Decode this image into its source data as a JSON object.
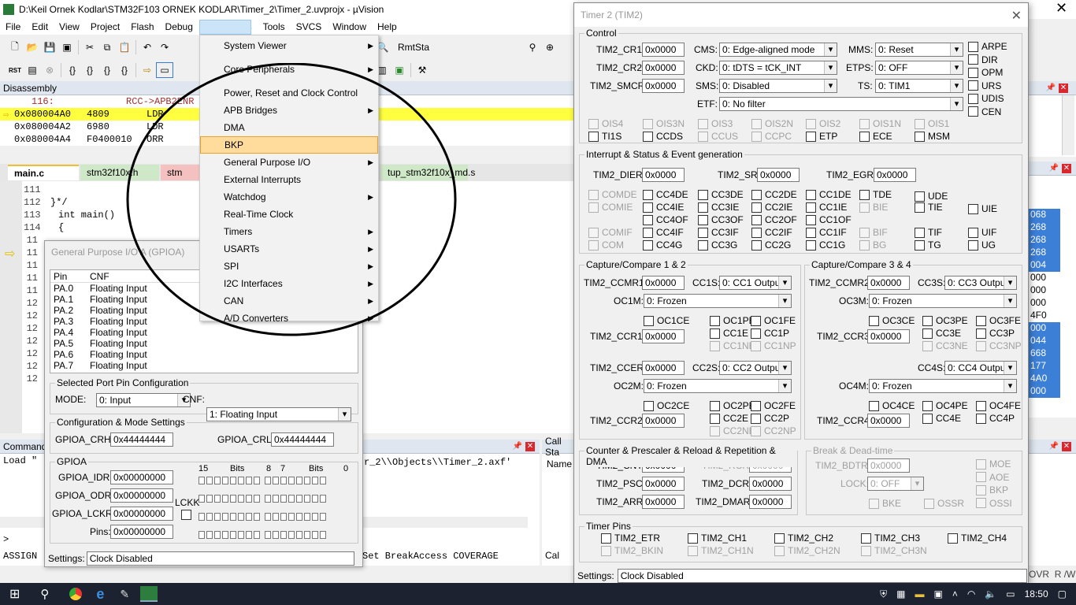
{
  "window_title": "D:\\Keil Ornek Kodlar\\STM32F103 ORNEK KODLAR\\Timer_2\\Timer_2.uvprojx - µVision",
  "menubar": [
    "File",
    "Edit",
    "View",
    "Project",
    "Flash",
    "Debug",
    "Peripherals",
    "Tools",
    "SVCS",
    "Window",
    "Help"
  ],
  "toolbar": {
    "rmtsta": "RmtSta",
    "rst": "RST"
  },
  "disassembly": {
    "title": "Disassembly",
    "lines": [
      {
        "addr": "116:",
        "op": "",
        "instr": "RCC->APB2ENR"
      },
      {
        "addr": "0x080004A0",
        "op": "4809",
        "instr": "LDR"
      },
      {
        "addr": "0x080004A2",
        "op": "6980",
        "instr": "LDR"
      },
      {
        "addr": "0x080004A4",
        "op": "F0400010",
        "instr": "ORR"
      }
    ]
  },
  "editor": {
    "tabs": [
      "main.c",
      "stm32f10x.h",
      "stm",
      "tup_stm32f10x_md.s"
    ],
    "lines": [
      {
        "n": "111",
        "t": ""
      },
      {
        "n": "112",
        "t": "}*/"
      },
      {
        "n": "113",
        "t": "int main()"
      },
      {
        "n": "114",
        "t": "{"
      },
      {
        "n": "11",
        "t": ""
      },
      {
        "n": "11",
        "t": ""
      },
      {
        "n": "11",
        "t": ""
      },
      {
        "n": "11",
        "t": ""
      },
      {
        "n": "11",
        "t": ""
      },
      {
        "n": "12",
        "t": ""
      },
      {
        "n": "12",
        "t": ""
      },
      {
        "n": "12",
        "t": ""
      },
      {
        "n": "12",
        "t": ""
      },
      {
        "n": "12",
        "t": ""
      },
      {
        "n": "12",
        "t": ""
      },
      {
        "n": "12",
        "t": ""
      }
    ]
  },
  "peripherals_menu": [
    {
      "label": "System Viewer",
      "sub": true
    },
    {
      "label": "Core Peripherals",
      "sub": true
    },
    {
      "label": "Power, Reset and Clock Control",
      "sub": false
    },
    {
      "label": "APB Bridges",
      "sub": true
    },
    {
      "label": "DMA",
      "sub": false
    },
    {
      "label": "BKP",
      "sub": false
    },
    {
      "label": "General Purpose I/O",
      "sub": true
    },
    {
      "label": "External Interrupts",
      "sub": false
    },
    {
      "label": "Watchdog",
      "sub": true
    },
    {
      "label": "Real-Time Clock",
      "sub": false
    },
    {
      "label": "Timers",
      "sub": true
    },
    {
      "label": "USARTs",
      "sub": true
    },
    {
      "label": "SPI",
      "sub": true
    },
    {
      "label": "I2C Interfaces",
      "sub": true
    },
    {
      "label": "CAN",
      "sub": true
    },
    {
      "label": "A/D Converters",
      "sub": true
    }
  ],
  "gpioa": {
    "title": "General Purpose I/O A (GPIOA)",
    "col_pin": "Pin",
    "col_cnf": "CNF",
    "pins": [
      {
        "pin": "PA.0",
        "cnf": "Floating Input"
      },
      {
        "pin": "PA.1",
        "cnf": "Floating Input"
      },
      {
        "pin": "PA.2",
        "cnf": "Floating Input"
      },
      {
        "pin": "PA.3",
        "cnf": "Floating Input"
      },
      {
        "pin": "PA.4",
        "cnf": "Floating Input"
      },
      {
        "pin": "PA.5",
        "cnf": "Floating Input"
      },
      {
        "pin": "PA.6",
        "cnf": "Floating Input"
      },
      {
        "pin": "PA.7",
        "cnf": "Floating Input"
      }
    ],
    "sel_group": "Selected Port Pin Configuration",
    "mode_label": "MODE:",
    "mode_value": "0: Input",
    "cnf_label": "CNF:",
    "cnf_value": "1: Floating Input",
    "cfg_group": "Configuration & Mode Settings",
    "crh_label": "GPIOA_CRH:",
    "crh_value": "0x44444444",
    "crl_label": "GPIOA_CRL:",
    "crl_value": "0x44444444",
    "gpioa_group": "GPIOA",
    "idr_label": "GPIOA_IDR:",
    "idr_value": "0x00000000",
    "odr_label": "GPIOA_ODR:",
    "odr_value": "0x00000000",
    "lckr_label": "GPIOA_LCKR:",
    "lckr_value": "0x00000000",
    "pins_label": "Pins:",
    "pins_value": "0x00000000",
    "lckk": "LCKK",
    "bits_hdr": [
      "15",
      "Bits",
      "8",
      "7",
      "Bits",
      "0"
    ],
    "settings_label": "Settings:",
    "settings_value": "Clock Disabled"
  },
  "command": {
    "title": "Command",
    "line1": "Load \"",
    "line2": "r_2\\\\Objects\\\\Timer_2.axf'",
    "prompt": ">",
    "status": "ASSIGN",
    "status2": "Set BreakAccess COVERAGE"
  },
  "callstack": {
    "title": "Call Sta",
    "name": "Name",
    "tab": "Cal"
  },
  "memory_vals": [
    "068",
    "268",
    "268",
    "268",
    "004",
    "000",
    "000",
    "000",
    "4F0",
    "000",
    "044",
    "668",
    "177",
    "4A0",
    "000"
  ],
  "tim2": {
    "title": "Timer 2 (TIM2)",
    "control": "Control",
    "cr1_l": "TIM2_CR1:",
    "cr1": "0x0000",
    "cr2_l": "TIM2_CR2:",
    "cr2": "0x0000",
    "smcr_l": "TIM2_SMCR:",
    "smcr": "0x0000",
    "cms_l": "CMS:",
    "cms": "0: Edge-aligned mode",
    "ckd_l": "CKD:",
    "ckd": "0: tDTS = tCK_INT",
    "sms_l": "SMS:",
    "sms": "0: Disabled",
    "etf_l": "ETF:",
    "etf": "0:  No filter",
    "mms_l": "MMS:",
    "mms": "0: Reset",
    "etps_l": "ETPS:",
    "etps": "0: OFF",
    "ts_l": "TS:",
    "ts": "0: TIM1",
    "cr_flags": [
      "ARPE",
      "DIR",
      "OPM",
      "URS",
      "UDIS",
      "CEN"
    ],
    "ois_row": [
      "OIS4",
      "OIS3N",
      "OIS3",
      "OIS2N",
      "OIS2",
      "OIS1N",
      "OIS1"
    ],
    "ti_row": [
      "TI1S",
      "CCDS",
      "CCUS",
      "CCPC",
      "ETP",
      "ECE",
      "MSM"
    ],
    "interrupt": "Interrupt & Status & Event generation",
    "dier_l": "TIM2_DIER:",
    "dier": "0x0000",
    "sr_l": "TIM2_SR:",
    "sr": "0x0000",
    "egr_l": "TIM2_EGR:",
    "egr": "0x0000",
    "int_rows": [
      [
        "COMDE",
        "CC4DE",
        "CC3DE",
        "CC2DE",
        "CC1DE",
        "TDE",
        "UDE"
      ],
      [
        "COMIE",
        "CC4IE",
        "CC3IE",
        "CC2IE",
        "CC1IE",
        "BIE",
        "TIE",
        "UIE"
      ],
      [
        "",
        "CC4OF",
        "CC3OF",
        "CC2OF",
        "CC1OF"
      ],
      [
        "COMIF",
        "CC4IF",
        "CC3IF",
        "CC2IF",
        "CC1IF",
        "BIF",
        "TIF",
        "UIF"
      ],
      [
        "COM",
        "CC4G",
        "CC3G",
        "CC2G",
        "CC1G",
        "BG",
        "TG",
        "UG"
      ]
    ],
    "cc12": "Capture/Compare 1 & 2",
    "ccmr1_l": "TIM2_CCMR1:",
    "ccmr1": "0x0000",
    "cc1s_l": "CC1S:",
    "cc1s": "0: CC1 Output",
    "oc1m_l": "OC1M:",
    "oc1m": "0: Frozen",
    "ccr1_l": "TIM2_CCR1:",
    "ccr1": "0x0000",
    "ccer_l": "TIM2_CCER:",
    "ccer": "0x0000",
    "cc2s_l": "CC2S:",
    "cc2s": "0: CC2 Output",
    "oc2m_l": "OC2M:",
    "oc2m": "0: Frozen",
    "ccr2_l": "TIM2_CCR2:",
    "ccr2": "0x0000",
    "oc1_flags": [
      "OC1CE",
      "OC1PE",
      "OC1FE",
      "CC1E",
      "CC1P",
      "CC1NE",
      "CC1NP"
    ],
    "oc2_flags": [
      "OC2CE",
      "OC2PE",
      "OC2FE",
      "CC2E",
      "CC2P",
      "CC2NE",
      "CC2NP"
    ],
    "cc34": "Capture/Compare 3 & 4",
    "ccmr2_l": "TIM2_CCMR2:",
    "ccmr2": "0x0000",
    "cc3s_l": "CC3S:",
    "cc3s": "0: CC3 Output",
    "oc3m_l": "OC3M:",
    "oc3m": "0: Frozen",
    "ccr3_l": "TIM2_CCR3:",
    "ccr3": "0x0000",
    "cc4s_l": "CC4S:",
    "cc4s": "0: CC4 Output",
    "oc4m_l": "OC4M:",
    "oc4m": "0: Frozen",
    "ccr4_l": "TIM2_CCR4:",
    "ccr4": "0x0000",
    "oc3_flags": [
      "OC3CE",
      "OC3PE",
      "OC3FE",
      "CC3E",
      "CC3P",
      "CC3NE",
      "CC3NP"
    ],
    "oc4_flags": [
      "OC4CE",
      "OC4PE",
      "OC4FE",
      "CC4E",
      "CC4P"
    ],
    "counter": "Counter & Prescaler & Reload & Repetition & DMA",
    "cnt_l": "TIM2_CNT:",
    "cnt": "0x0000",
    "psc_l": "TIM2_PSC:",
    "psc": "0x0000",
    "arr_l": "TIM2_ARR:",
    "arr": "0x0000",
    "rcr_l": "TIM2_RCR:",
    "rcr": "0x0000",
    "dcr_l": "TIM2_DCR:",
    "dcr": "0x0000",
    "dmar_l": "TIM2_DMAR:",
    "dmar": "0x0000",
    "brk": "Break & Dead-time",
    "bdtr_l": "TIM2_BDTR:",
    "bdtr": "0x0000",
    "lock_l": "LOCK:",
    "lock": "0: OFF",
    "brk_flags": [
      "MOE",
      "AOE",
      "BKP",
      "OSSI"
    ],
    "bke": "BKE",
    "ossr": "OSSR",
    "pins": "Timer Pins",
    "pin_row1": [
      "TIM2_ETR",
      "TIM2_CH1",
      "TIM2_CH2",
      "TIM2_CH3",
      "TIM2_CH4"
    ],
    "pin_row2": [
      "TIM2_BKIN",
      "TIM2_CH1N",
      "TIM2_CH2N",
      "TIM2_CH3N"
    ],
    "settings_l": "Settings:",
    "settings": "Clock Disabled"
  },
  "statusbar": {
    "ovr": "OVR",
    "rw": "R /W"
  },
  "taskbar": {
    "time": "18:50"
  }
}
